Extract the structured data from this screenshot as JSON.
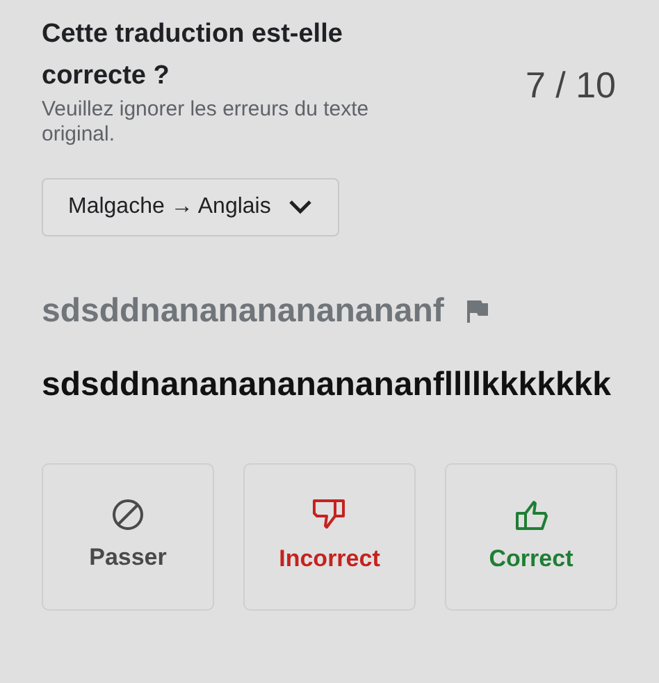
{
  "question": {
    "title": "Cette traduction est-elle correcte ?",
    "hint": "Veuillez ignorer les erreurs du texte original.",
    "progress": "7 / 10"
  },
  "language_pair": {
    "value": "Malgache → Anglais"
  },
  "source_text": "sdsddnanananananananf",
  "translation": "sdsddnanananananananfllllkkkkkkk",
  "buttons": [
    {
      "kind": "skip",
      "label": "Passer",
      "color": "#4a4a4a"
    },
    {
      "kind": "incorrect",
      "label": "Incorrect",
      "color": "#c5221f"
    },
    {
      "kind": "correct",
      "label": "Correct",
      "color": "#1e7e34"
    }
  ]
}
